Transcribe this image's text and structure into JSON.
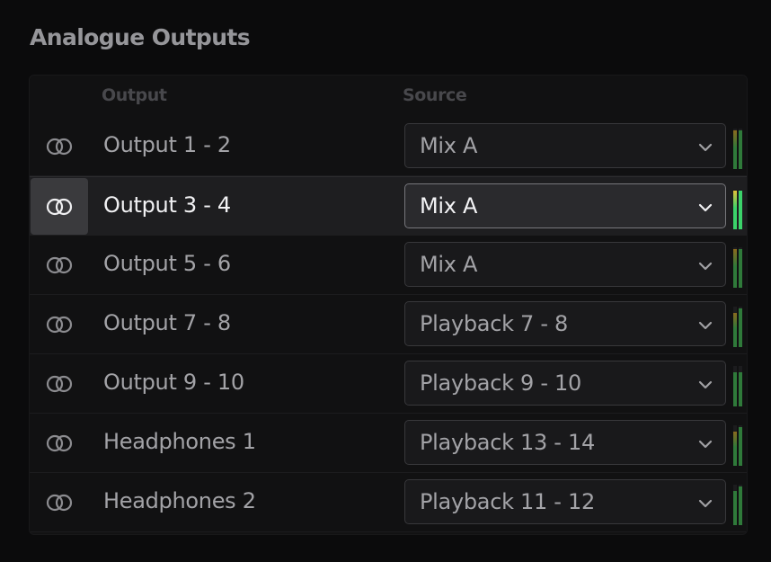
{
  "section": {
    "title": "Analogue Outputs"
  },
  "table": {
    "headers": {
      "output": "Output",
      "source": "Source"
    },
    "rows": [
      {
        "output": "Output 1 - 2",
        "source": "Mix A",
        "selected": false,
        "meter": {
          "left": 0.95,
          "right": 0.95,
          "left_color": "#8a6a1e",
          "right_color": "#2f7a3a",
          "intensity": "dim"
        }
      },
      {
        "output": "Output 3 - 4",
        "source": "Mix A",
        "selected": true,
        "meter": {
          "left": 0.95,
          "right": 0.95,
          "left_color": "#e3c13a",
          "right_color": "#3bd36a",
          "intensity": "bright"
        }
      },
      {
        "output": "Output 5 - 6",
        "source": "Mix A",
        "selected": false,
        "meter": {
          "left": 0.95,
          "right": 0.95,
          "left_color": "#8a6a1e",
          "right_color": "#2f7a3a",
          "intensity": "dim"
        }
      },
      {
        "output": "Output 7 - 8",
        "source": "Playback 7 - 8",
        "selected": false,
        "meter": {
          "left": 0.85,
          "right": 0.95,
          "left_color": "#8a6a1e",
          "right_color": "#2f7a3a",
          "intensity": "dim"
        }
      },
      {
        "output": "Output 9 - 10",
        "source": "Playback 9 - 10",
        "selected": false,
        "meter": {
          "left": 0.85,
          "right": 0.85,
          "left_color": "#2f7a3a",
          "right_color": "#2f7a3a",
          "intensity": "dim"
        }
      },
      {
        "output": "Headphones 1",
        "source": "Playback 13 - 14",
        "selected": false,
        "meter": {
          "left": 0.85,
          "right": 0.95,
          "left_color": "#8a6a1e",
          "right_color": "#2f7a3a",
          "intensity": "dim"
        }
      },
      {
        "output": "Headphones 2",
        "source": "Playback 11 - 12",
        "selected": false,
        "meter": {
          "left": 0.85,
          "right": 0.95,
          "left_color": "#2f7a3a",
          "right_color": "#2f7a3a",
          "intensity": "dim"
        }
      }
    ]
  },
  "icons": {
    "link": "link-stereo-icon",
    "chevron": "chevron-down-icon"
  },
  "colors": {
    "background": "#0b0b0c",
    "panel": "#121213",
    "selected_row": "#1e1e20",
    "meter_green": "#3bd36a",
    "meter_yellow": "#e3c13a"
  }
}
